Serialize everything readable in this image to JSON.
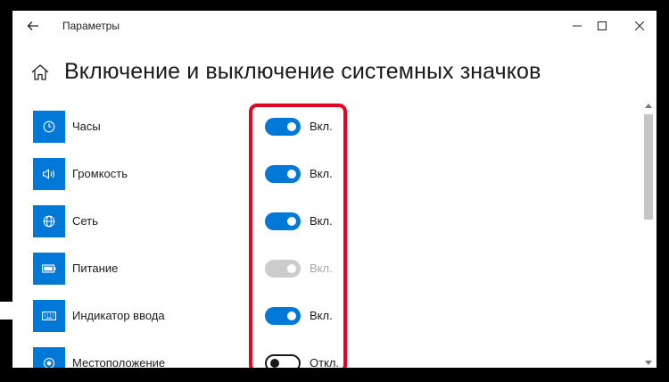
{
  "window": {
    "title": "Параметры"
  },
  "page": {
    "title": "Включение и выключение системных значков"
  },
  "items": [
    {
      "label": "Часы",
      "icon": "clock-icon",
      "state": "on",
      "state_label": "Вкл."
    },
    {
      "label": "Громкость",
      "icon": "speaker-icon",
      "state": "on",
      "state_label": "Вкл."
    },
    {
      "label": "Сеть",
      "icon": "globe-icon",
      "state": "on",
      "state_label": "Вкл."
    },
    {
      "label": "Питание",
      "icon": "battery-icon",
      "state": "disabled",
      "state_label": "Вкл."
    },
    {
      "label": "Индикатор ввода",
      "icon": "keyboard-icon",
      "state": "on",
      "state_label": "Вкл."
    },
    {
      "label": "Местоположение",
      "icon": "location-icon",
      "state": "off",
      "state_label": "Откл."
    }
  ],
  "colors": {
    "accent": "#0078d7",
    "highlight": "#e3051d",
    "disabled": "#cccccc"
  }
}
